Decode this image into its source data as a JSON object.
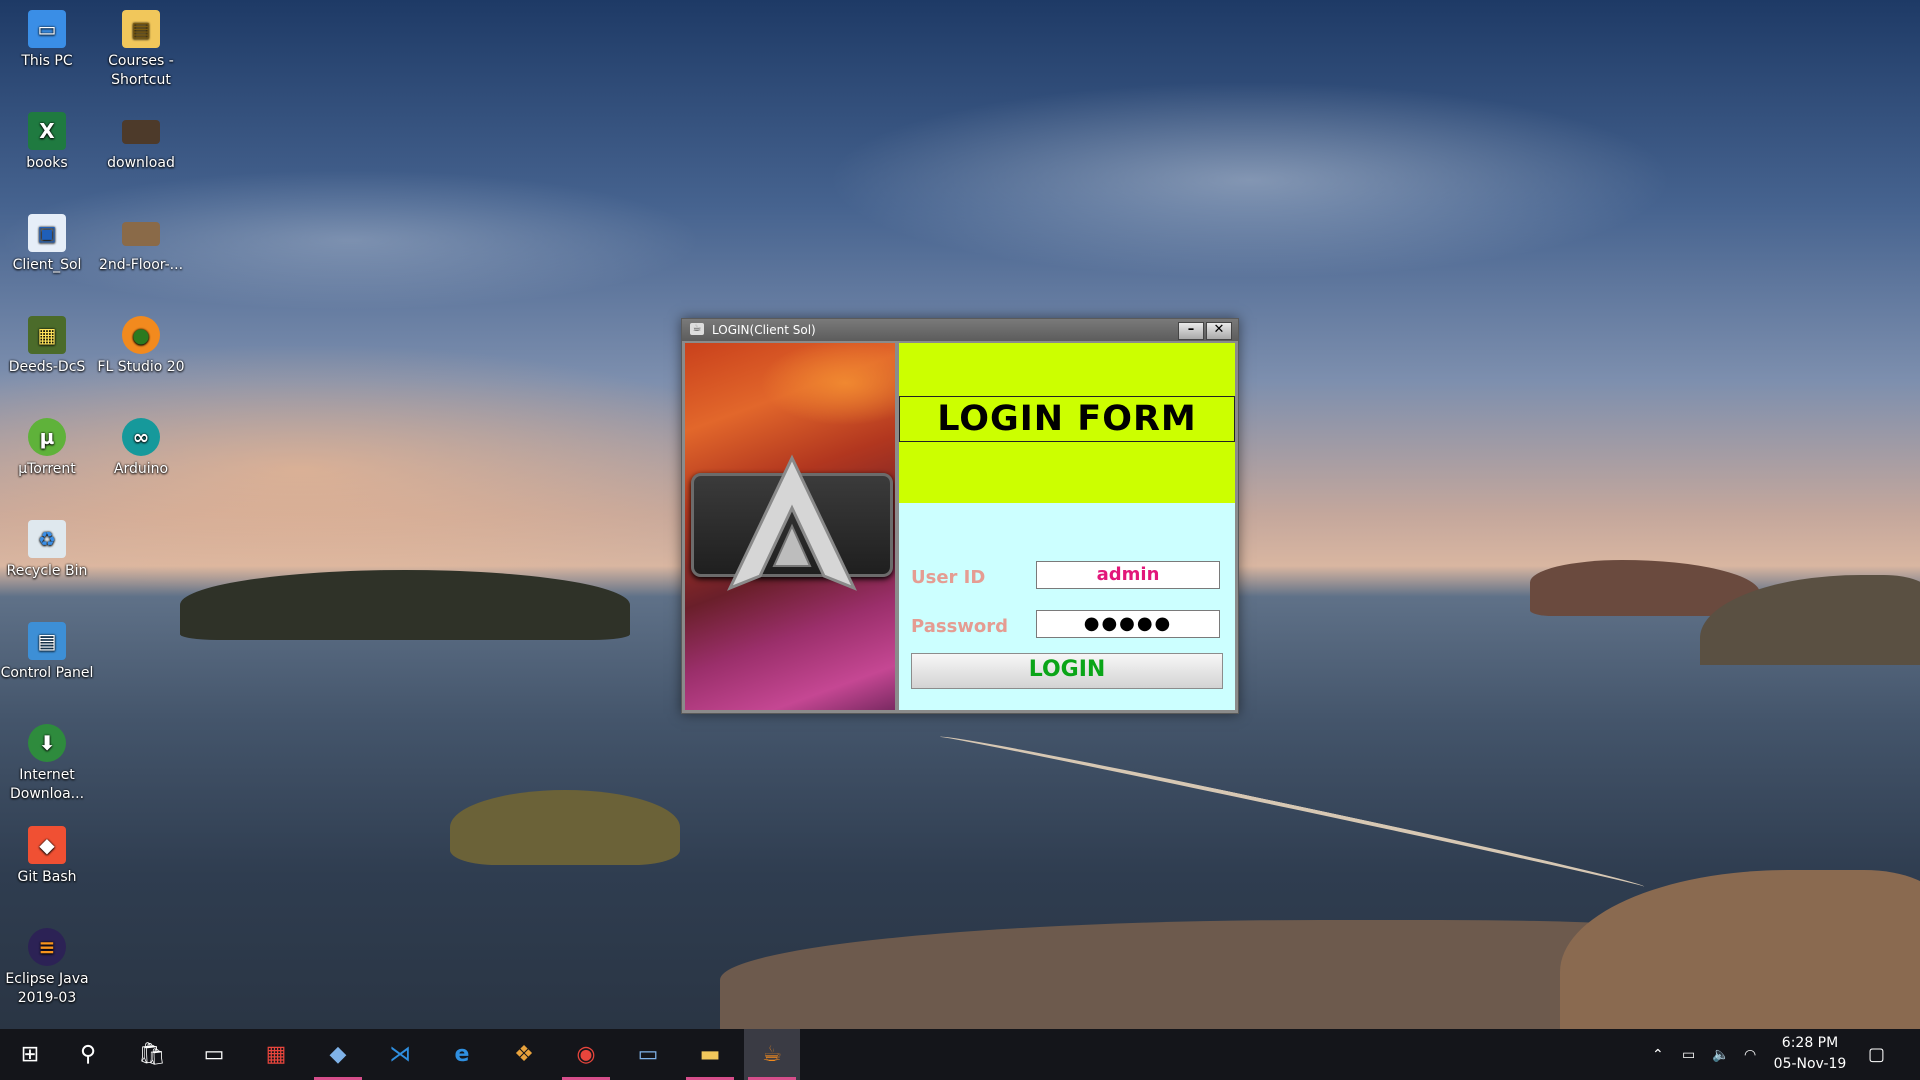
{
  "desktop": {
    "icons": [
      {
        "label": "This PC",
        "icon": "computer-icon"
      },
      {
        "label": "Courses - Shortcut",
        "icon": "folder-shortcut-icon"
      },
      {
        "label": "books",
        "icon": "excel-file-icon"
      },
      {
        "label": "download",
        "icon": "image-file-icon"
      },
      {
        "label": "Client_Sol",
        "icon": "app-shortcut-icon"
      },
      {
        "label": "2nd-Floor-...",
        "icon": "image-file-icon"
      },
      {
        "label": "Deeds-DcS",
        "icon": "circuit-app-icon"
      },
      {
        "label": "FL Studio 20",
        "icon": "fruit-app-icon"
      },
      {
        "label": "µTorrent",
        "icon": "torrent-icon"
      },
      {
        "label": "Arduino",
        "icon": "arduino-icon"
      },
      {
        "label": "Recycle Bin",
        "icon": "recycle-bin-icon"
      },
      {
        "label": "Control Panel",
        "icon": "control-panel-icon"
      },
      {
        "label": "Internet Downloa...",
        "icon": "download-manager-icon"
      },
      {
        "label": "Git Bash",
        "icon": "git-icon"
      },
      {
        "label": "Eclipse Java 2019-03",
        "icon": "eclipse-icon"
      }
    ]
  },
  "window": {
    "title": "LOGIN(Client Sol)",
    "minimize": "–",
    "close": "✕",
    "header_title": "LOGIN FORM",
    "userid_label": "User ID",
    "userid_value": "admin",
    "password_label": "Password",
    "password_value": "●●●●●",
    "login_button": "LOGIN",
    "colors": {
      "header_bg": "#ccff00",
      "form_bg": "#ccffff",
      "label": "#e59c92",
      "user_value": "#e2177a",
      "button_text": "#0aa518"
    }
  },
  "taskbar": {
    "items": [
      "start-icon",
      "search-icon",
      "store-icon",
      "terminal-icon",
      "office-icon",
      "box-app-icon",
      "vscode-icon",
      "edge-icon",
      "git-client-icon",
      "chrome-icon",
      "mysql-icon",
      "file-explorer-icon",
      "java-icon"
    ],
    "time": "6:28 PM",
    "date": "05-Nov-19"
  }
}
